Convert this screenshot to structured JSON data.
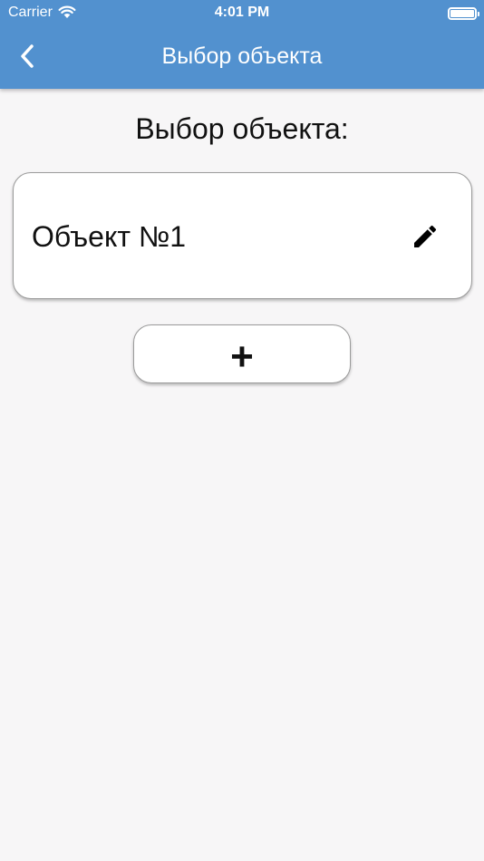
{
  "status_bar": {
    "carrier": "Carrier",
    "time": "4:01 PM",
    "icons": [
      "wifi-icon",
      "battery-icon"
    ]
  },
  "nav": {
    "back_icon": "chevron-left-icon",
    "title": "Выбор объекта"
  },
  "main": {
    "heading": "Выбор объекта:",
    "objects": [
      {
        "name": "Объект №1",
        "edit_icon": "pencil-icon"
      }
    ],
    "add_button_label": "+"
  },
  "colors": {
    "header": "#5291cf",
    "background": "#f7f6f7",
    "card": "#ffffff",
    "card_border": "#9b9b9b",
    "text": "#111111"
  }
}
